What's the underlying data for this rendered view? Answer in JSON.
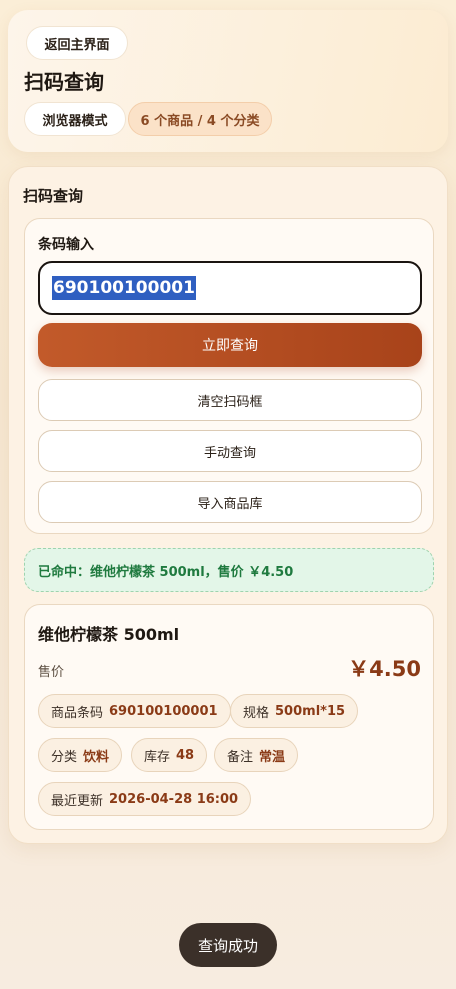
{
  "header": {
    "back_label": "返回主界面",
    "title": "扫码查询",
    "mode_label": "浏览器模式",
    "count_badge": "6 个商品 / 4 个分类"
  },
  "scan": {
    "section_title": "扫码查询",
    "input_label": "条码输入",
    "input_value": "690100100001",
    "query_label": "立即查询",
    "clear_label": "清空扫码框",
    "manual_label": "手动查询",
    "import_label": "导入商品库"
  },
  "result": {
    "hit_message": "已命中：维他柠檬茶 500ml，售价 ￥4.50"
  },
  "product": {
    "name": "维他柠檬茶 500ml",
    "price_label": "售价",
    "price": "￥4.50",
    "chips": [
      {
        "label": "商品条码",
        "value": "690100100001"
      },
      {
        "label": "规格",
        "value": "500ml*15"
      },
      {
        "label": "分类",
        "value": "饮料"
      },
      {
        "label": "库存",
        "value": "48"
      },
      {
        "label": "备注",
        "value": "常温"
      },
      {
        "label": "最近更新",
        "value": "2026-04-28 16:00"
      }
    ]
  },
  "toast": {
    "message": "查询成功"
  },
  "colors": {
    "accent": "#a8431a",
    "success": "#1f7a3f",
    "toast_bg": "#3b3029"
  }
}
